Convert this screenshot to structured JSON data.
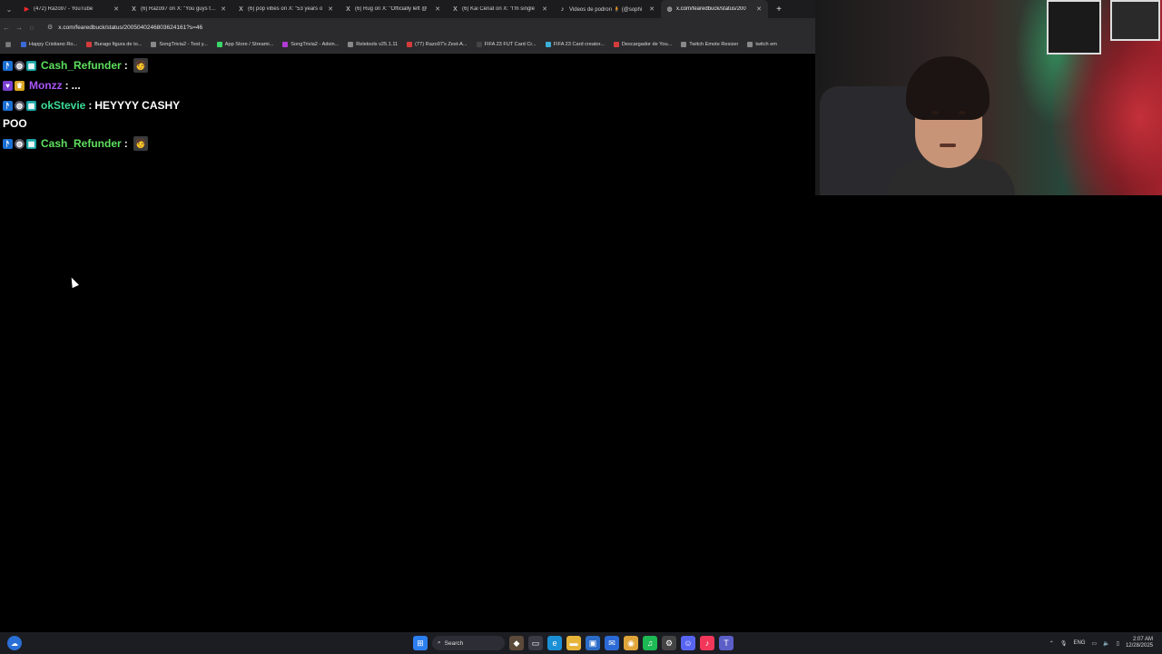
{
  "browser": {
    "tabs": [
      {
        "title": "(472) Razo97 - YouTube",
        "icon": "youtube-icon",
        "active": false
      },
      {
        "title": "(6) Razo97 on X: \"You guys talk",
        "icon": "x-icon",
        "active": false
      },
      {
        "title": "(6) pop vibes on X: \"53 years o",
        "icon": "x-icon",
        "active": false
      },
      {
        "title": "(6) Rug on X: \"Officially left @",
        "icon": "x-icon",
        "active": false
      },
      {
        "title": "(6) Kai Cenat on X: \"I'm single",
        "icon": "x-icon",
        "active": false
      },
      {
        "title": "Videos de podron 🧍 (@sophi",
        "icon": "tiktok-icon",
        "active": false
      },
      {
        "title": "x.com/fearedbuck/status/200",
        "icon": "globe-icon",
        "active": true
      }
    ],
    "url": "x.com/fearedbuck/status/2005040246803624161?s=46",
    "bookmarks": [
      {
        "label": "Happy Cristiano Ro...",
        "color": "#3b6ad6"
      },
      {
        "label": "Burago figura de to...",
        "color": "#d63b3b"
      },
      {
        "label": "SongTrivia2 - Test y...",
        "color": "#888888"
      },
      {
        "label": "App Store / Streami...",
        "color": "#3bd66a"
      },
      {
        "label": "SongTrivia2 - Advin...",
        "color": "#b03bd6"
      },
      {
        "label": "Reletools v25.1.11",
        "color": "#888888"
      },
      {
        "label": "(77) Razo97's Zest-A...",
        "color": "#d63b3b"
      },
      {
        "label": "FIFA 23 FUT Card Cr...",
        "color": "#444444"
      },
      {
        "label": "FIFA 23 Card creator...",
        "color": "#3bb0d6"
      },
      {
        "label": "Descargador de You...",
        "color": "#d63b3b"
      },
      {
        "label": "Twitch Emote Resizer",
        "color": "#888888"
      },
      {
        "label": "twitch em",
        "color": "#888888"
      }
    ]
  },
  "chat": {
    "messages": [
      {
        "user": "Cash_Refunder",
        "color": "#5ee05e",
        "text": "",
        "emote": "man-emote"
      },
      {
        "user": "Monzz",
        "color": "#a855f7",
        "text": "...",
        "emote": ""
      },
      {
        "user": "okStevie",
        "color": "#3ddc97",
        "text": "HEYYYY CASHY",
        "text2": "POO",
        "emote": ""
      },
      {
        "user": "Cash_Refunder",
        "color": "#5ee05e",
        "text": "",
        "emote": "man-emote"
      }
    ],
    "separator": ":"
  },
  "taskbar": {
    "search_label": "Search",
    "lang": "ENG",
    "time": "2:07 AM",
    "date": "12/28/2025"
  }
}
